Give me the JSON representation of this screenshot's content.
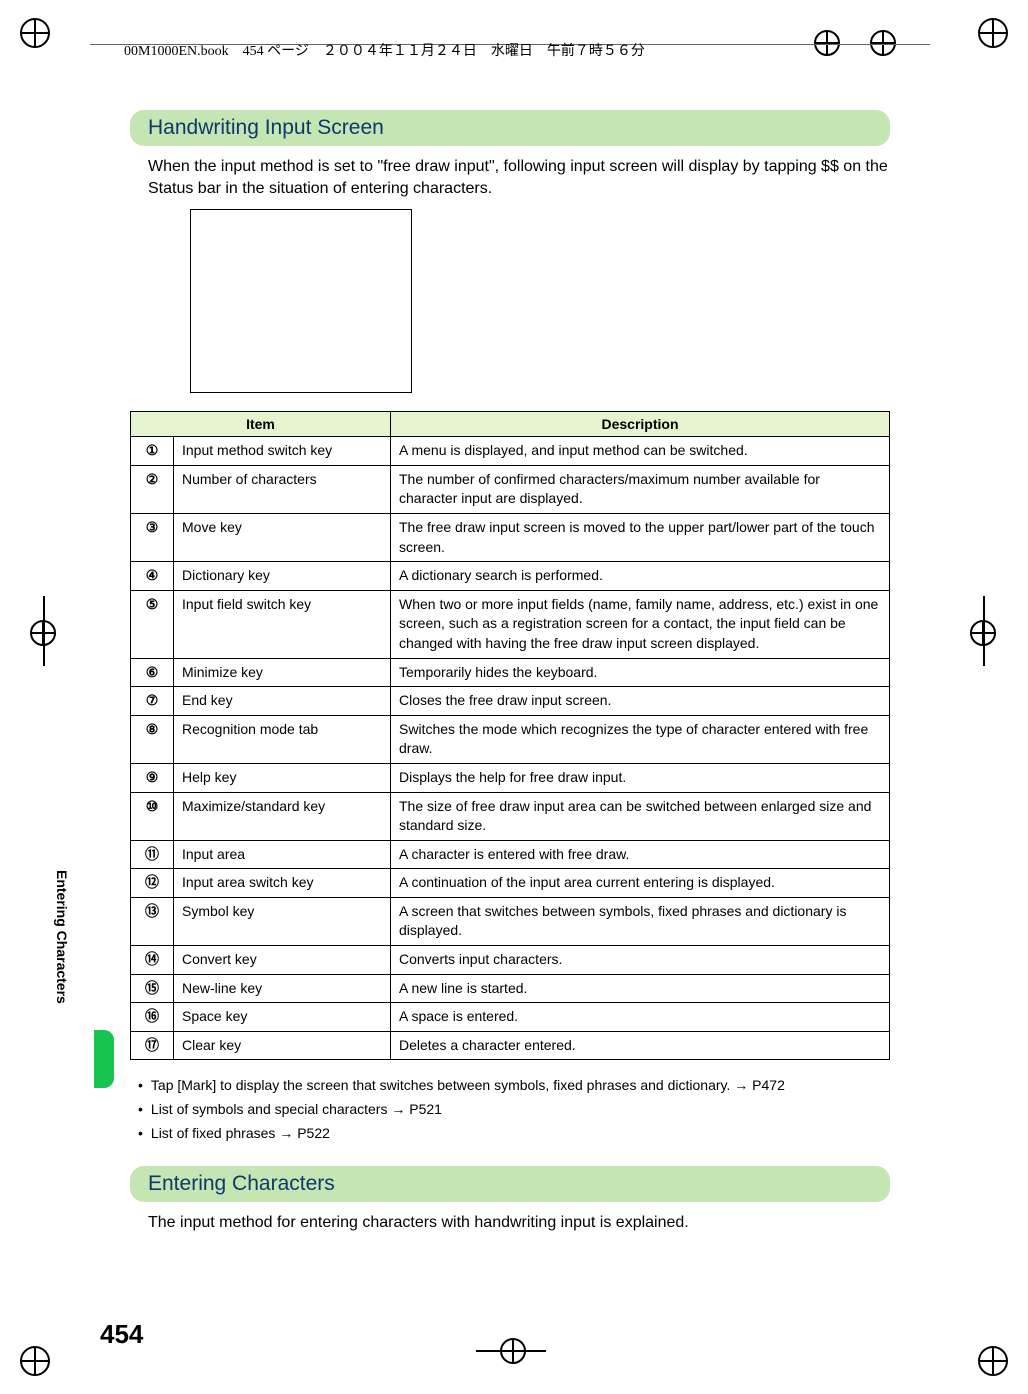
{
  "header_line": "00M1000EN.book　454 ページ　２００４年１１月２４日　水曜日　午前７時５６分",
  "section1": {
    "title": "Handwriting Input Screen",
    "intro": "When the input method is set to \"free draw input\", following input screen will display by tapping $$ on the Status bar in the situation of entering characters."
  },
  "table": {
    "head_item": "Item",
    "head_desc": "Description",
    "rows": [
      {
        "n": "①",
        "item": "Input method switch key",
        "desc": "A menu is displayed, and input method can be switched."
      },
      {
        "n": "②",
        "item": "Number of characters",
        "desc": "The number of confirmed characters/maximum number available for character input are displayed."
      },
      {
        "n": "③",
        "item": "Move key",
        "desc": "The free draw input screen is moved to the upper part/lower part of the touch screen."
      },
      {
        "n": "④",
        "item": "Dictionary key",
        "desc": "A dictionary search is performed."
      },
      {
        "n": "⑤",
        "item": "Input field switch key",
        "desc": "When two or more input fields (name, family name, address, etc.) exist in one screen, such as a registration screen for a contact, the input field can be changed with having the free draw input screen displayed."
      },
      {
        "n": "⑥",
        "item": "Minimize key",
        "desc": "Temporarily hides the keyboard."
      },
      {
        "n": "⑦",
        "item": "End key",
        "desc": "Closes the free draw input screen."
      },
      {
        "n": "⑧",
        "item": "Recognition mode tab",
        "desc": "Switches the mode which recognizes the type of character entered with free draw."
      },
      {
        "n": "⑨",
        "item": "Help key",
        "desc": "Displays the help for free draw input."
      },
      {
        "n": "⑩",
        "item": "Maximize/standard key",
        "desc": "The size of free draw input area can be switched between enlarged size and standard size."
      },
      {
        "n": "⑪",
        "item": "Input area",
        "desc": "A character is entered with free draw."
      },
      {
        "n": "⑫",
        "item": "Input area switch key",
        "desc": "A continuation of the input area current entering is displayed."
      },
      {
        "n": "⑬",
        "item": "Symbol key",
        "desc": "A screen that switches between symbols, fixed phrases and dictionary is displayed."
      },
      {
        "n": "⑭",
        "item": "Convert key",
        "desc": "Converts input characters."
      },
      {
        "n": "⑮",
        "item": "New-line key",
        "desc": "A new line is started."
      },
      {
        "n": "⑯",
        "item": "Space key",
        "desc": "A space is entered."
      },
      {
        "n": "⑰",
        "item": "Clear key",
        "desc": "Deletes a character entered."
      }
    ]
  },
  "bullets": [
    "Tap [Mark] to display the screen that switches between symbols, fixed phrases and dictionary. → P472",
    "List of symbols and special characters → P521",
    "List of fixed phrases → P522"
  ],
  "section2": {
    "title": "Entering Characters",
    "intro": "The input method for entering characters with handwriting input is explained."
  },
  "side_label": "Entering Characters",
  "page_number": "454"
}
